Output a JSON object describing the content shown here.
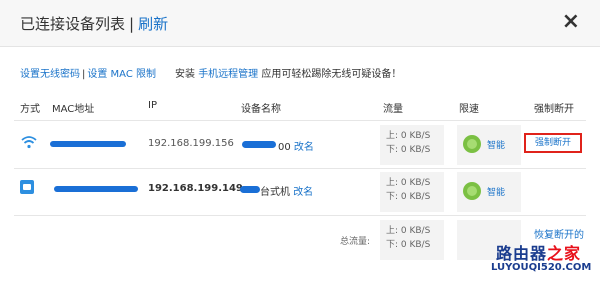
{
  "header": {
    "title": "已连接设备列表",
    "separator": "|",
    "refresh_label": "刷新",
    "close_glyph": "×"
  },
  "links": {
    "set_wifi_password": "设置无线密码",
    "separator": "|",
    "set_mac_limit": "设置 MAC 限制"
  },
  "notice": {
    "prefix": "安装",
    "app_link": "手机远程管理",
    "suffix": "应用可轻松踢除无线可疑设备！"
  },
  "table": {
    "headers": {
      "type": "方式",
      "mac": "MAC地址",
      "ip": "IP",
      "device_name": "设备名称",
      "traffic": "流量",
      "speed_limit": "限速",
      "force_disconnect": "强制断开"
    },
    "rows": [
      {
        "connection": "wifi-icon",
        "ip": "192.168.199.156",
        "name_suffix": "00",
        "rename": "改名",
        "up": "上: 0 KB/S",
        "down": "下: 0 KB/S",
        "limit": "智能",
        "action": "强制断开"
      },
      {
        "connection": "lan-icon",
        "ip": "192.168.199.149",
        "name_suffix": "台式机",
        "rename": "改名",
        "up": "上: 0 KB/S",
        "down": "下: 0 KB/S",
        "limit": "智能"
      }
    ],
    "total": {
      "label": "总流量:",
      "up": "上: 0 KB/S",
      "down": "下: 0 KB/S",
      "restore": "恢复断开的"
    }
  },
  "watermark": {
    "cn_part1": "路由器",
    "cn_part2": "之家",
    "en": "LUYOUQI520.COM"
  },
  "colors": {
    "link": "#1a73c9",
    "highlight_border": "#e0231b",
    "mask": "#1a6fd6",
    "smart_icon": "#7bc043"
  }
}
